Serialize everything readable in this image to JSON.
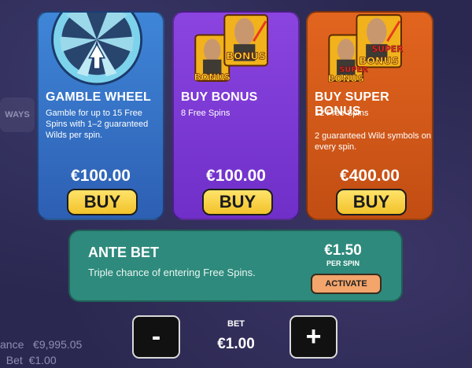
{
  "background": {
    "ways_label": "WAYS",
    "balance_label": "ance",
    "balance_value": "€9,995.05",
    "bet_label": "Bet",
    "bet_value": "€1.00"
  },
  "cards": [
    {
      "title": "GAMBLE WHEEL",
      "description": "Gamble for up to 15 Free Spins with 1–2 guaranteed Wilds per spin.",
      "description_extra": "",
      "price": "€100.00",
      "button_label": "BUY",
      "color": "#3f86d8"
    },
    {
      "title": "BUY BONUS",
      "description": "8 Free Spins",
      "description_extra": "",
      "price": "€100.00",
      "button_label": "BUY",
      "color": "#8b44e0",
      "art_labels": [
        "BONUS",
        "BONUS"
      ]
    },
    {
      "title": "BUY SUPER BONUS",
      "description": "12 Free Spins",
      "description_extra": "2 guaranteed Wild symbols on every spin.",
      "price": "€400.00",
      "button_label": "BUY",
      "color": "#e2651f",
      "art_labels": [
        "SUPER",
        "BONUS",
        "SUPER",
        "BONUS"
      ]
    }
  ],
  "ante": {
    "title": "ANTE BET",
    "description": "Triple chance of entering Free Spins.",
    "price": "€1.50",
    "per_label": "PER SPIN",
    "button_label": "ACTIVATE",
    "color": "#2e8a7c"
  },
  "bet": {
    "minus_label": "-",
    "plus_label": "+",
    "label": "BET",
    "value": "€1.00"
  }
}
